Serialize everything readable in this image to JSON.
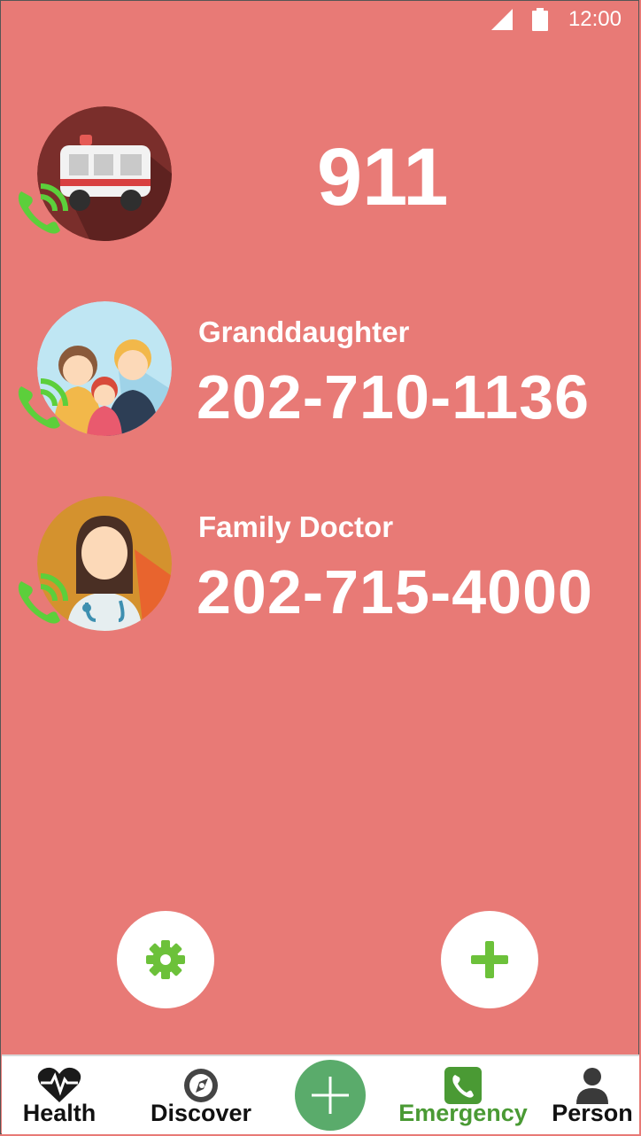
{
  "status_bar": {
    "time": "12:00"
  },
  "contacts": [
    {
      "name": "",
      "number": "911",
      "avatar": "ambulance-avatar"
    },
    {
      "name": "Granddaughter",
      "number": "202-710-1136",
      "avatar": "family-avatar"
    },
    {
      "name": "Family Doctor",
      "number": "202-715-4000",
      "avatar": "doctor-avatar"
    }
  ],
  "actions": {
    "settings_icon": "gear-icon",
    "add_icon": "plus-icon"
  },
  "bottom_nav": {
    "items": [
      {
        "label": "Health",
        "icon": "heart-pulse-icon"
      },
      {
        "label": "Discover",
        "icon": "compass-icon"
      },
      {
        "label": "Emergency",
        "icon": "phone-icon",
        "active": true
      },
      {
        "label": "Person",
        "icon": "person-icon"
      }
    ]
  },
  "colors": {
    "background": "#e87a76",
    "accent_green": "#6cc13a",
    "active_nav": "#4a9a34",
    "center_button": "#5aab6b"
  }
}
